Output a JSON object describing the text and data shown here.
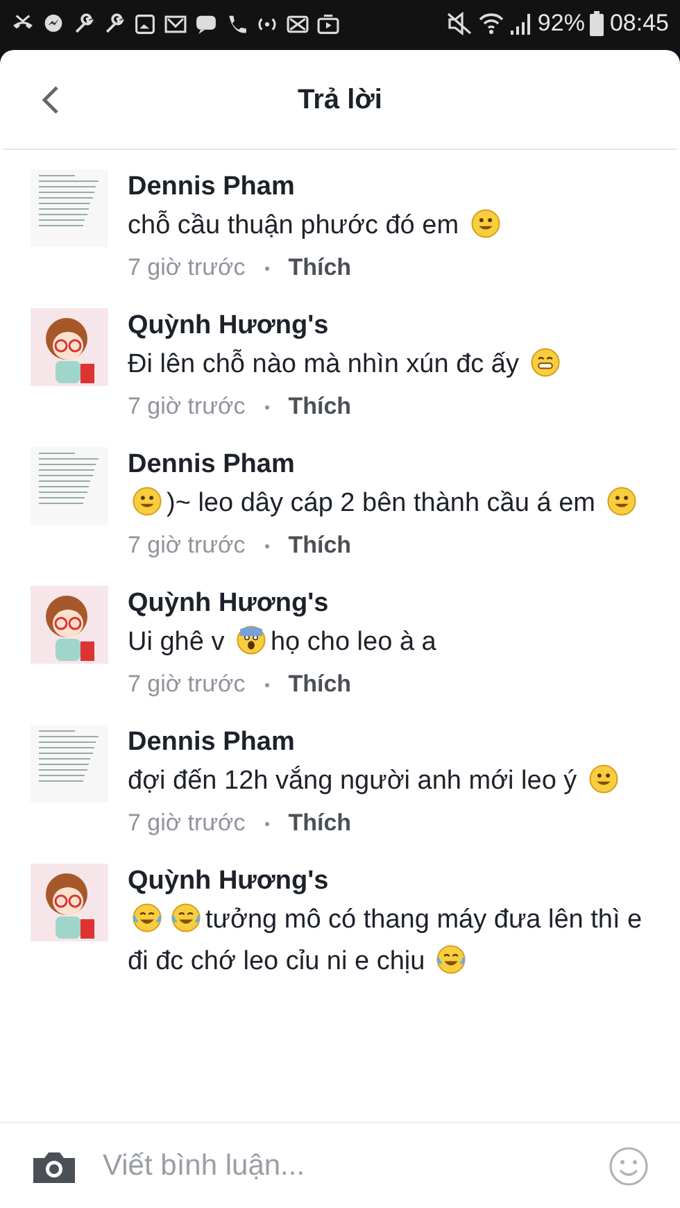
{
  "status_bar": {
    "battery": "92%",
    "time": "08:45"
  },
  "header": {
    "title": "Trả lời"
  },
  "comments": [
    {
      "author": "Dennis Pham",
      "avatar": {
        "kind": "document"
      },
      "parts": [
        {
          "kind": "text",
          "text": "chỗ cầu thuận phước đó em"
        },
        {
          "kind": "smile"
        }
      ],
      "time": "7 giờ trước",
      "like": "Thích"
    },
    {
      "author": "Quỳnh Hương's",
      "avatar": {
        "kind": "cartoon"
      },
      "parts": [
        {
          "kind": "text",
          "text": "Đi lên chỗ nào mà nhìn xún đc ấy"
        },
        {
          "kind": "grin"
        }
      ],
      "time": "7 giờ trước",
      "like": "Thích"
    },
    {
      "author": "Dennis Pham",
      "avatar": {
        "kind": "document"
      },
      "parts": [
        {
          "kind": "smile"
        },
        {
          "kind": "text",
          "text": ")~ leo dây cáp 2 bên thành cầu á em"
        },
        {
          "kind": "smile"
        }
      ],
      "time": "7 giờ trước",
      "like": "Thích"
    },
    {
      "author": "Quỳnh Hương's",
      "avatar": {
        "kind": "cartoon"
      },
      "parts": [
        {
          "kind": "text",
          "text": "Ui ghê v"
        },
        {
          "kind": "fearful"
        },
        {
          "kind": "text",
          "text": "họ cho leo à a"
        }
      ],
      "time": "7 giờ trước",
      "like": "Thích"
    },
    {
      "author": "Dennis Pham",
      "avatar": {
        "kind": "document"
      },
      "parts": [
        {
          "kind": "text",
          "text": "đợi đến 12h vắng người anh mới leo ý"
        },
        {
          "kind": "smile"
        }
      ],
      "time": "7 giờ trước",
      "like": "Thích"
    },
    {
      "author": "Quỳnh Hương's",
      "avatar": {
        "kind": "cartoon"
      },
      "parts": [
        {
          "kind": "joy"
        },
        {
          "kind": "joy"
        },
        {
          "kind": "text",
          "text": "tưởng mô có thang máy đưa lên thì e đi đc chớ leo cỉu ni e chịu"
        },
        {
          "kind": "joy"
        }
      ]
    }
  ],
  "composer": {
    "placeholder": "Viết bình luận..."
  }
}
